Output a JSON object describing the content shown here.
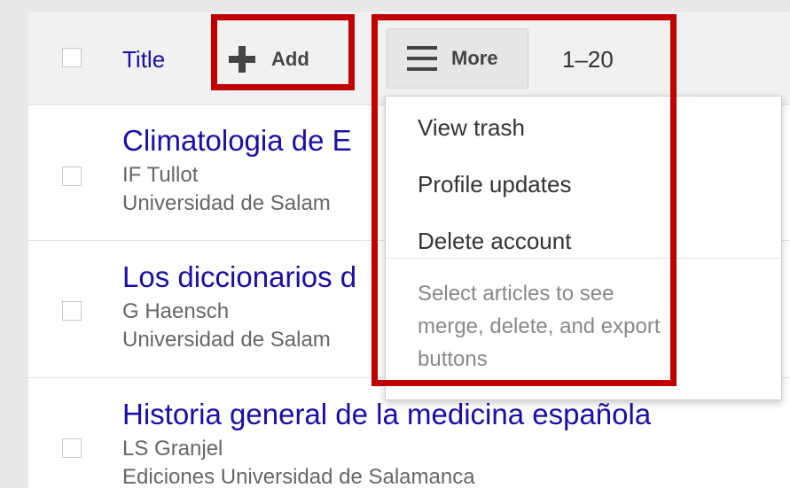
{
  "toolbar": {
    "title_label": "Title",
    "add_label": "Add",
    "more_label": "More",
    "pager": "1–20"
  },
  "menu": {
    "items": [
      {
        "label": "View trash"
      },
      {
        "label": "Profile updates"
      },
      {
        "label": "Delete account"
      }
    ],
    "hint": "Select articles to see merge, delete, and export buttons"
  },
  "articles": [
    {
      "title": "Climatologia de E",
      "authors": "IF Tullot",
      "venue": "Universidad de Salam"
    },
    {
      "title": "Los diccionarios d",
      "authors": "G Haensch",
      "venue": "Universidad de Salam"
    },
    {
      "title": "Historia general de la medicina española",
      "authors": "LS Granjel",
      "venue": "Ediciones Universidad de Salamanca"
    }
  ],
  "colors": {
    "highlight": "#c00000",
    "link": "#1a0dab"
  },
  "icons": [
    "plus-icon",
    "menu-icon"
  ]
}
